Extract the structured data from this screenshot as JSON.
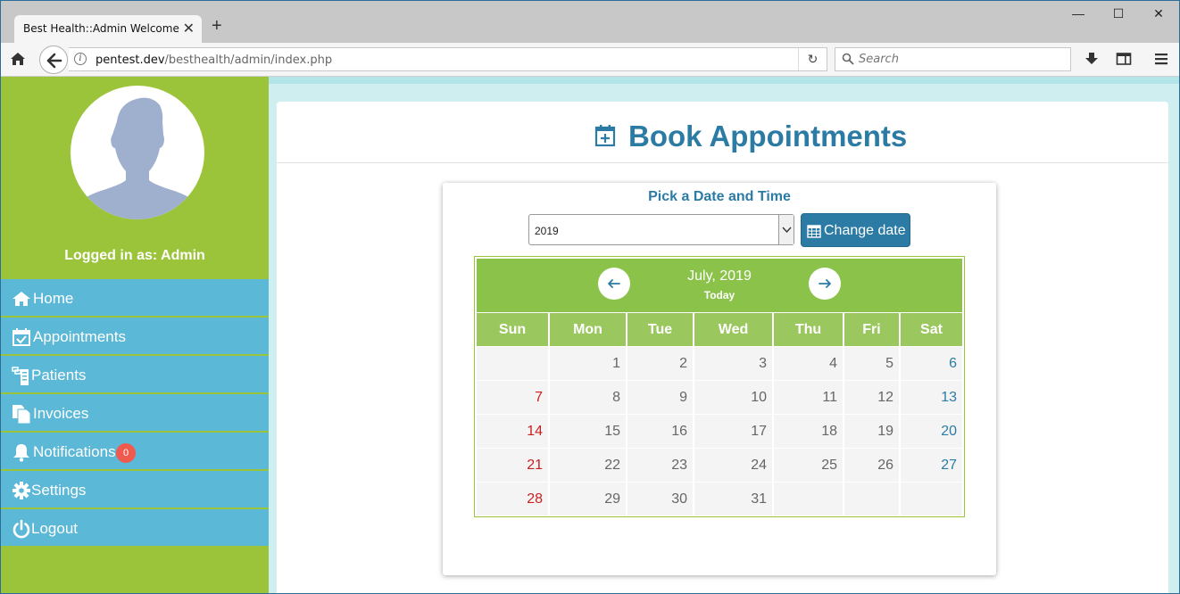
{
  "browser": {
    "tab_title": "Best Health::Admin Welcome",
    "url_host": "pentest.dev",
    "url_path": "/besthealth/admin/index.php",
    "search_placeholder": "Search"
  },
  "sidebar": {
    "logged_in": "Logged in as: Admin",
    "items": [
      {
        "label": "Home",
        "icon": "home-icon"
      },
      {
        "label": "Appointments",
        "icon": "calendar-check-icon"
      },
      {
        "label": "Patients",
        "icon": "patients-icon"
      },
      {
        "label": "Invoices",
        "icon": "invoice-icon"
      },
      {
        "label": "Notifications",
        "icon": "bell-icon"
      },
      {
        "label": "Settings",
        "icon": "gear-icon"
      },
      {
        "label": "Logout",
        "icon": "power-icon"
      }
    ],
    "notification_count": "0"
  },
  "main": {
    "title": "Book Appointments",
    "pick_label": "Pick a Date and Time",
    "year_value": "2019",
    "change_date_label": "Change date",
    "calendar": {
      "month_label": "July, 2019",
      "today_label": "Today",
      "days_of_week": [
        "Sun",
        "Mon",
        "Tue",
        "Wed",
        "Thu",
        "Fri",
        "Sat"
      ],
      "weeks": [
        [
          "",
          "1",
          "2",
          "3",
          "4",
          "5",
          "6"
        ],
        [
          "7",
          "8",
          "9",
          "10",
          "11",
          "12",
          "13"
        ],
        [
          "14",
          "15",
          "16",
          "17",
          "18",
          "19",
          "20"
        ],
        [
          "21",
          "22",
          "23",
          "24",
          "25",
          "26",
          "27"
        ],
        [
          "28",
          "29",
          "30",
          "31",
          "",
          "",
          ""
        ]
      ]
    }
  },
  "colors": {
    "sidebar_green": "#9bc43a",
    "menu_blue": "#5bb8d6",
    "accent_blue": "#2b7ba5",
    "calendar_green": "#8bc34a",
    "sunday_red": "#c9211f"
  }
}
